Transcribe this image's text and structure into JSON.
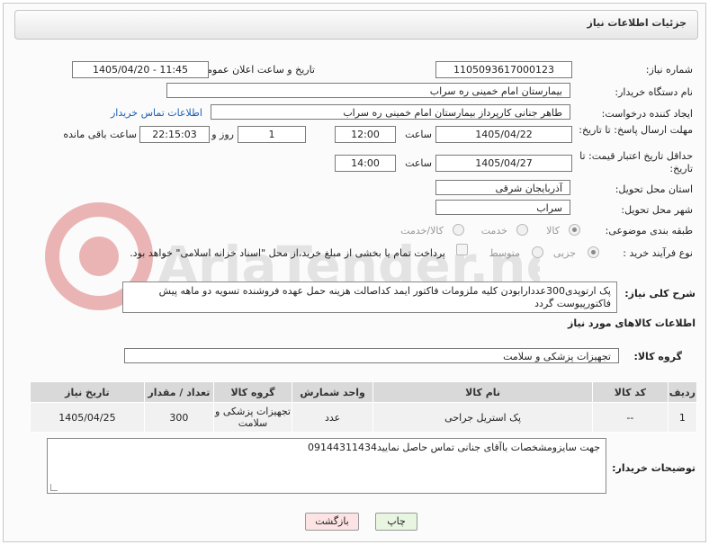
{
  "header": {
    "title": "جزئیات اطلاعات نیاز"
  },
  "form": {
    "need_number_label": "شماره نیاز:",
    "need_number": "1105093617000123",
    "announce_label": "تاریخ و ساعت اعلان عمومی:",
    "announce_value": "1405/04/20 - 11:45",
    "buyer_org_label": "نام دستگاه خریدار:",
    "buyer_org": "بیمارستان امام خمینی ره  سراب",
    "creator_label": "ایجاد کننده درخواست:",
    "creator": "طاهر جنانی کارپرداز بیمارستان امام خمینی ره  سراب",
    "buyer_contact_link": "اطلاعات تماس خریدار",
    "deadline_label": "مهلت ارسال پاسخ: تا تاریخ:",
    "deadline_date": "1405/04/22",
    "time_label": "ساعت",
    "deadline_time": "12:00",
    "days_value": "1",
    "days_label": "روز و",
    "remaining_time": "22:15:03",
    "remaining_label": "ساعت باقی مانده",
    "validity_label": "حداقل تاریخ اعتبار قیمت: تا تاریخ:",
    "validity_date": "1405/04/27",
    "validity_time": "14:00",
    "province_label": "استان محل تحویل:",
    "province": "آذربایجان شرقی",
    "city_label": "شهر محل تحویل:",
    "city": "سراب",
    "category_label": "طبقه بندی موضوعی:",
    "category_options": [
      "کالا",
      "خدمت",
      "کالا/خدمت"
    ],
    "process_label": "نوع فرآیند خرید :",
    "process_options": [
      "جزیی",
      "متوسط"
    ],
    "payment_note": "پرداخت تمام یا بخشی از مبلغ خرید،از محل \"اسناد خزانه اسلامی\" خواهد بود.",
    "description_label": "شرح کلی نیاز:",
    "description": "پک ارتوپدی300عددارابودن کلیه ملزومات فاکتور ایمد کداصالت هزینه حمل عهده فروشنده تسویه دو ماهه پیش فاکتورپیوست گردد"
  },
  "goods": {
    "section_title": "اطلاعات کالاهای مورد نیاز",
    "group_label": "گروه کالا:",
    "group_value": "تجهیزات پزشکی و سلامت",
    "columns": [
      "ردیف",
      "کد کالا",
      "نام کالا",
      "واحد شمارش",
      "تعداد / مقدار",
      "تاریخ نیاز"
    ],
    "rows": [
      {
        "row": "1",
        "code": "--",
        "name": "پک استریل جراحی",
        "unit": "عدد",
        "qty": "300",
        "date": "1405/04/25"
      }
    ],
    "group_cell": "تجهیزات پزشکی و سلامت",
    "group_header": "گروه کالا"
  },
  "buyer_notes": {
    "label": "توضیحات خریدار:",
    "text": "جهت سایزومشخصات باآقای جنانی تماس حاصل نمایید09144311434"
  },
  "actions": {
    "print": "چاپ",
    "back": "بازگشت"
  },
  "watermark_text": "AriaTender.net",
  "colors": {
    "link": "#1a5fb4",
    "back_button": "#fde3e3",
    "print_button": "#e8f5e1"
  }
}
